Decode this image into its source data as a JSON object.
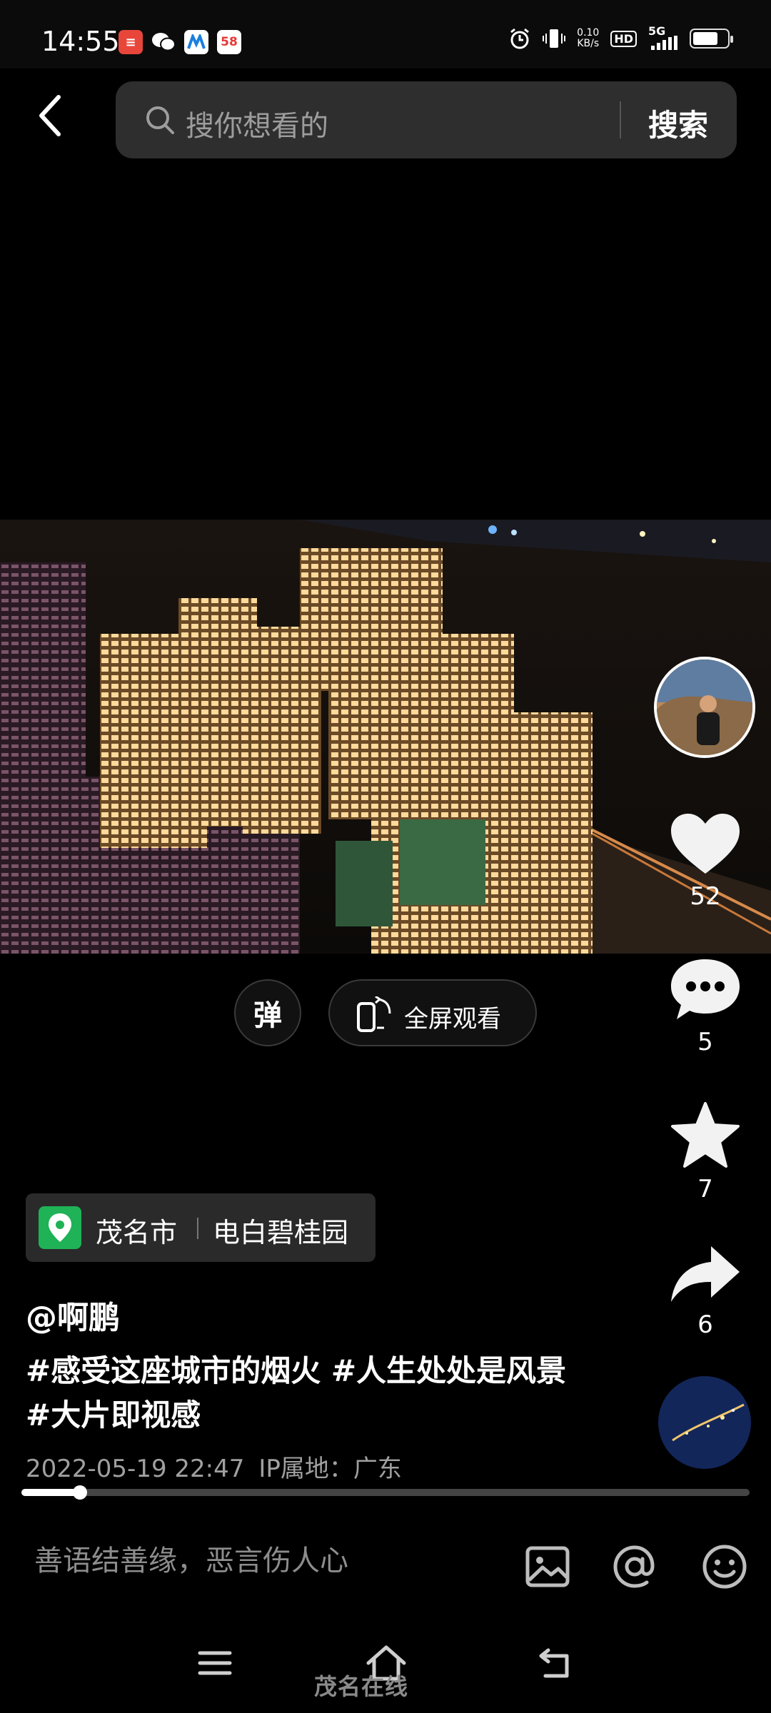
{
  "status_bar": {
    "time": "14:55",
    "net_speed_value": "0.10",
    "net_speed_unit": "KB/s",
    "hd_label": "HD",
    "network_label": "5G",
    "app_icons": [
      "news-app-icon",
      "wechat-icon",
      "maps-app-icon",
      "58-app-icon"
    ],
    "app_58_label": "58"
  },
  "search": {
    "placeholder": "搜你想看的",
    "button_label": "搜索"
  },
  "video_controls": {
    "danmu_label": "弹",
    "fullscreen_label": "全屏观看"
  },
  "actions": {
    "like_count": "52",
    "comment_count": "5",
    "favorite_count": "7",
    "share_count": "6"
  },
  "location": {
    "city": "茂名市",
    "place": "电白碧桂园"
  },
  "post": {
    "author": "@啊鹏",
    "description": "#感受这座城市的烟火 #人生处处是风景 #大片即视感",
    "date": "2022-05-19 22:47",
    "ip_location": "IP属地：广东"
  },
  "playback": {
    "progress_percent": 8
  },
  "comment_bar": {
    "placeholder": "善语结善缘，恶言伤人心"
  },
  "watermark": {
    "text": "茂名在线"
  },
  "colors": {
    "background": "#000000",
    "search_bg": "#2e2e2e",
    "location_pin": "#1fb256",
    "muted_text": "#a0a0a0"
  }
}
